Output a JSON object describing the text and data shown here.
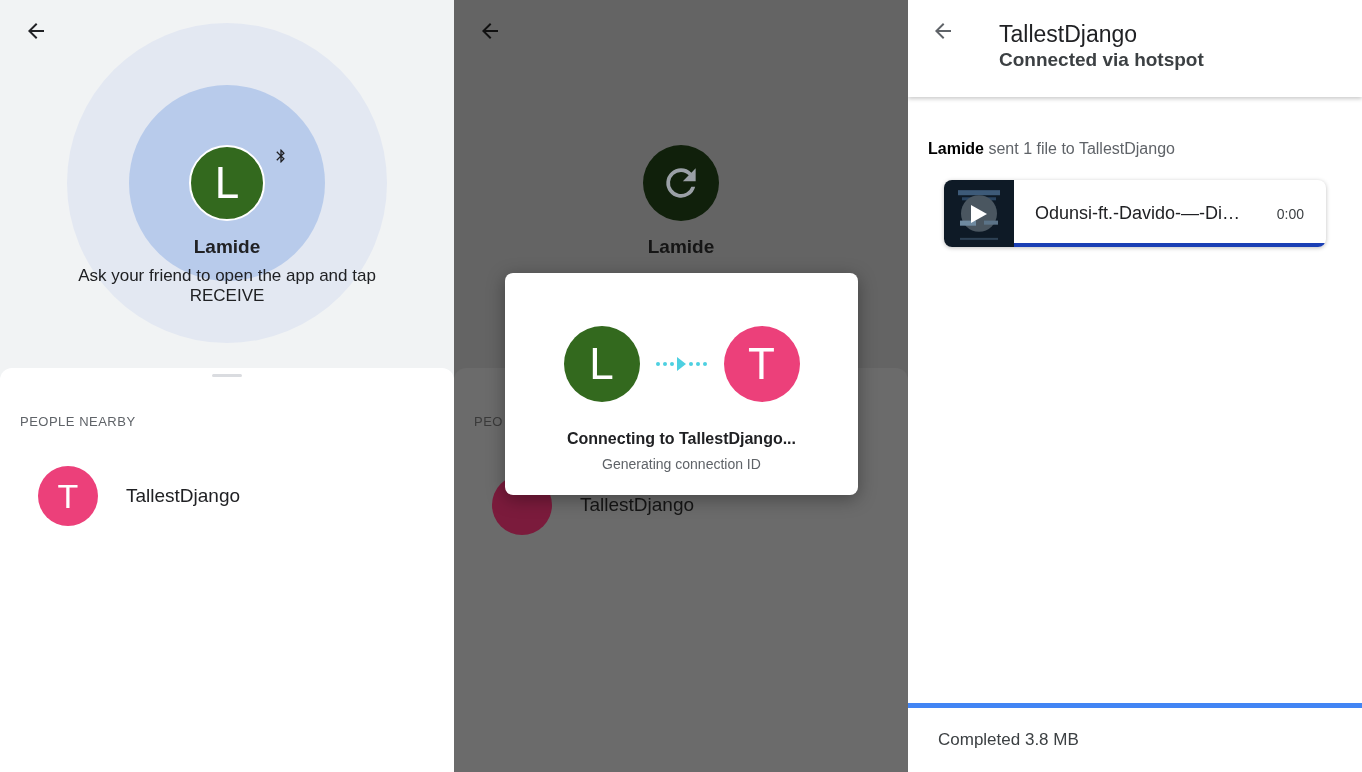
{
  "screens": [
    {
      "kind": "search",
      "self": {
        "initial": "L",
        "name": "Lamide",
        "color": "#33691e"
      },
      "hint": "Ask your friend to open the app and tap RECEIVE",
      "section_label": "PEOPLE NEARBY",
      "people": [
        {
          "initial": "T",
          "name": "TallestDjango",
          "color": "#ec407a"
        }
      ]
    },
    {
      "kind": "connecting",
      "self": {
        "name": "Lamide",
        "color": "#10200b"
      },
      "section_label": "PEO",
      "people": [
        {
          "name": "TallestDjango",
          "color": "#7b1b3c"
        }
      ],
      "dialog": {
        "from": {
          "initial": "L",
          "color": "#33691e"
        },
        "to": {
          "initial": "T",
          "color": "#ec407a"
        },
        "title": "Connecting to TallestDjango...",
        "subtitle": "Generating connection ID"
      }
    },
    {
      "kind": "transfer",
      "title": "TallestDjango",
      "subtitle": "Connected via hotspot",
      "summary": "**Lamide** sent 1 file to TallestDjango",
      "files": [
        {
          "kind": "video",
          "name": "Odunsi-ft.-Davido-—-Di…",
          "duration": "0:00",
          "level": 1
        }
      ],
      "status": "Completed 3.8 MB",
      "level": 1
    }
  ]
}
